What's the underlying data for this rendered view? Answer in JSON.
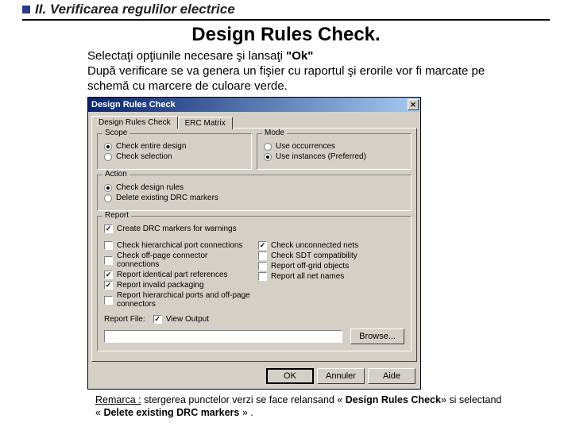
{
  "section_title": "II. Verificarea regulilor electrice",
  "main_title": "Design Rules Check.",
  "intro_line1_a": "Selectaţi opţiunile necesare şi lansaţi ",
  "intro_line1_b": "\"Ok\"",
  "intro_line2": "După verificare se va genera un fişier cu raportul şi erorile vor fi marcate pe schemă cu marcere de culoare verde.",
  "dialog": {
    "title": "Design Rules Check",
    "tabs": {
      "t1": "Design Rules Check",
      "t2": "ERC Matrix"
    },
    "groups": {
      "scope": {
        "title": "Scope",
        "r1": "Check entire design",
        "r2": "Check selection"
      },
      "mode": {
        "title": "Mode",
        "r1": "Use occurrences",
        "r2": "Use instances (Preferred)"
      },
      "action": {
        "title": "Action",
        "r1": "Check design rules",
        "r2": "Delete existing DRC markers"
      },
      "report": {
        "title": "Report",
        "c_warn": "Create DRC markers for warnings",
        "left": {
          "c1": "Check hierarchical port connections",
          "c2": "Check off-page connector connections",
          "c3": "Report identical part references",
          "c4": "Report invalid packaging",
          "c5": "Report hierarchical ports and off-page connectors"
        },
        "right": {
          "c1": "Check unconnected nets",
          "c2": "Check SDT compatibility",
          "c3": "Report off-grid objects",
          "c4": "Report all net names"
        },
        "file_label": "Report File:",
        "view_output": "View Output",
        "browse": "Browse..."
      }
    },
    "buttons": {
      "ok": "OK",
      "cancel": "Annuler",
      "help": "Aide"
    }
  },
  "remark": {
    "label": "Remarca :",
    "text_a": " stergerea punctelor verzi se face relansand « ",
    "bold_a": "Design Rules Check",
    "text_b": "» si selectand « ",
    "bold_b": "Delete existing DRC markers",
    "text_c": " » ."
  }
}
